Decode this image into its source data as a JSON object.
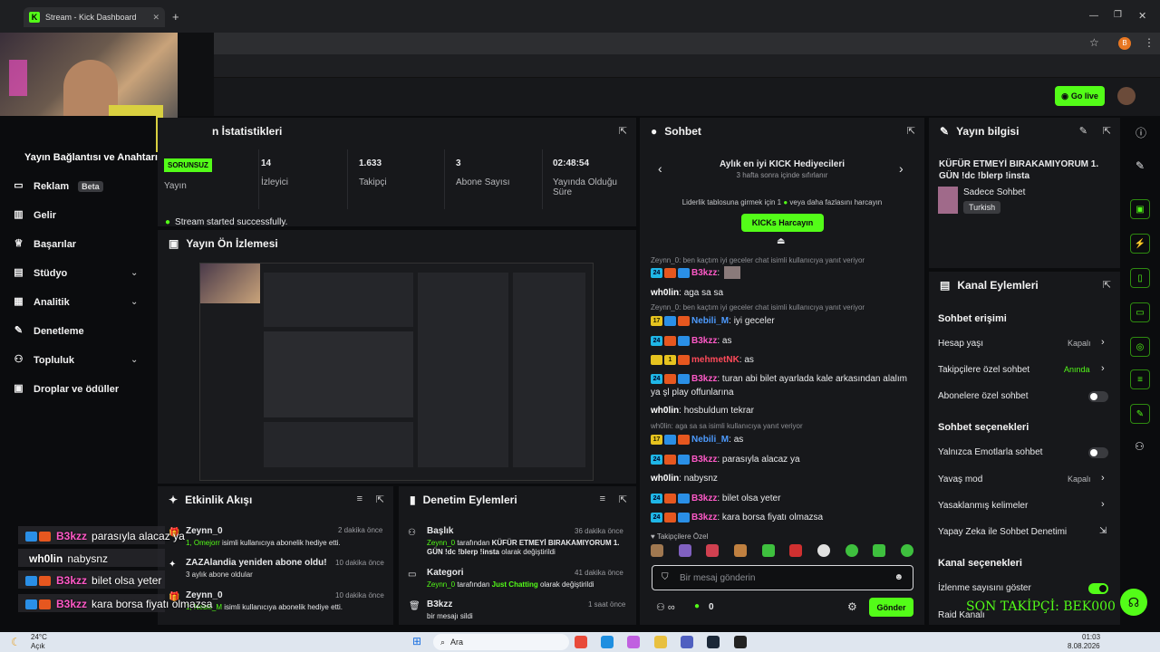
{
  "browser": {
    "tab_title": "Stream - Kick Dashboard",
    "tab_close": "✕",
    "new_tab": "+",
    "profile_initial": "B"
  },
  "header": {
    "go_live_label": "Go live"
  },
  "sidebar": {
    "title": "Yayın Bağlantısı ve Anahtarı",
    "items": [
      {
        "label": "Reklam",
        "badge": "Beta"
      },
      {
        "label": "Gelir"
      },
      {
        "label": "Başarılar"
      },
      {
        "label": "Stüdyo"
      },
      {
        "label": "Analitik"
      },
      {
        "label": "Denetleme"
      },
      {
        "label": "Topluluk"
      },
      {
        "label": "Droplar ve ödüller"
      }
    ]
  },
  "stats": {
    "title": "n İstatistikleri",
    "status_badge": "SORUNSUZ",
    "items": [
      {
        "value": "",
        "label": "Yayın"
      },
      {
        "value": "14",
        "label": "İzleyici"
      },
      {
        "value": "1.633",
        "label": "Takipçi"
      },
      {
        "value": "3",
        "label": "Abone Sayısı"
      },
      {
        "value": "02:48:54",
        "label": "Yayında Olduğu Süre"
      }
    ],
    "success_message": "Stream started successfully."
  },
  "preview": {
    "title": "Yayın Ön İzlemesi"
  },
  "activity": {
    "title": "Etkinlik Akışı",
    "events": [
      {
        "user": "Zeynn_0",
        "time": "2 dakika önce",
        "desc_user": "1, Omejorr",
        "desc": " isimli kullanıcıya abonelik hediye etti."
      },
      {
        "user": "ZAZAlandia yeniden abone oldu!",
        "time": "10 dakika önce",
        "desc_user": "",
        "desc": "3 aylık abone oldular"
      },
      {
        "user": "Zeynn_0",
        "time": "10 dakika önce",
        "desc_user": "1, Nebili_M",
        "desc": " isimli kullanıcıya abonelik hediye etti."
      }
    ]
  },
  "moderation": {
    "title": "Denetim Eylemleri",
    "items": [
      {
        "title": "Başlık",
        "time": "36 dakika önce",
        "who": "Zeynn_0",
        "mid": " tarafından ",
        "what": "KÜFÜR ETMEYİ BIRAKAMIYORUM 1. GÜN !dc !blerp !insta",
        "end": " olarak değiştirildi"
      },
      {
        "title": "Kategori",
        "time": "41 dakika önce",
        "who": "Zeynn_0",
        "mid": " tarafından ",
        "what": "Just Chatting",
        "end": " olarak değiştirildi"
      },
      {
        "title": "B3kzz",
        "time": "1 saat önce",
        "who": "",
        "mid": "",
        "what": "",
        "end": "bir mesajı sildi"
      }
    ]
  },
  "chat": {
    "title": "Sohbet",
    "gifters_title": "Aylık en iyi KICK Hediyecileri",
    "gifters_sub": "3 hafta sonra içinde sıfırlanır",
    "leaderboard_note": "Liderlik tablosuna girmek için 1 ",
    "leaderboard_note2": " veya daha fazlasını harcayın",
    "spend_button": "KICKs Harcayın",
    "followers_only": "Takipçilere Özel",
    "input_placeholder": "Bir mesaj gönderin",
    "send_button": "Gönder",
    "kicks_count": "0",
    "messages": [
      {
        "reply": "Zeynn_0: ben kaçtım iyi geceler chat isimli kullanıcıya yanıt veriyor",
        "badges": [
          "24",
          "mod",
          "sub"
        ],
        "user": "B3kzz",
        "color": "pink",
        "text": ""
      },
      {
        "reply": "",
        "badges": [],
        "user": "wh0lin",
        "color": "white",
        "text": "aga sa sa"
      },
      {
        "reply": "Zeynn_0: ben kaçtım iyi geceler chat isimli kullanıcıya yanıt veriyor",
        "badges": [
          "17",
          "sub",
          "mod"
        ],
        "user": "Nebili_M",
        "color": "blue",
        "text": "iyi geceler"
      },
      {
        "reply": "",
        "badges": [
          "24",
          "mod",
          "sub"
        ],
        "user": "B3kzz",
        "color": "pink",
        "text": "as"
      },
      {
        "reply": "",
        "badges": [
          "crown",
          "1",
          "mod"
        ],
        "user": "mehmetNK",
        "color": "red",
        "text": "as"
      },
      {
        "reply": "",
        "badges": [
          "24",
          "mod",
          "sub"
        ],
        "user": "B3kzz",
        "color": "pink",
        "text": "turan abi bilet ayarlada kale arkasından alalım ya şl play offunlarına"
      },
      {
        "reply": "",
        "badges": [],
        "user": "wh0lin",
        "color": "white",
        "text": "hosbuldum tekrar"
      },
      {
        "reply": "wh0lin: aga sa sa isimli kullanıcıya yanıt veriyor",
        "badges": [
          "17",
          "sub",
          "mod"
        ],
        "user": "Nebili_M",
        "color": "blue",
        "text": "as"
      },
      {
        "reply": "",
        "badges": [
          "24",
          "mod",
          "sub"
        ],
        "user": "B3kzz",
        "color": "pink",
        "text": "parasıyla alacaz ya"
      },
      {
        "reply": "",
        "badges": [],
        "user": "wh0lin",
        "color": "white",
        "text": "nabysnz"
      },
      {
        "reply": "",
        "badges": [
          "24",
          "mod",
          "sub"
        ],
        "user": "B3kzz",
        "color": "pink",
        "text": "bilet olsa yeter"
      },
      {
        "reply": "",
        "badges": [
          "24",
          "mod",
          "sub"
        ],
        "user": "B3kzz",
        "color": "pink",
        "text": "kara borsa fiyatı olmazsa"
      }
    ]
  },
  "stream_info": {
    "title": "Yayın bilgisi",
    "stream_title": "KÜFÜR ETMEYİ BIRAKAMIYORUM 1. GÜN !dc !blerp !insta",
    "category": "Sadece Sohbet",
    "language": "Turkish"
  },
  "channel_actions": {
    "title": "Kanal Eylemleri",
    "chat_access": "Sohbet erişimi",
    "rows1": [
      {
        "label": "Hesap yaşı",
        "value": "Kapalı"
      },
      {
        "label": "Takipçilere özel sohbet",
        "value": "Anında"
      },
      {
        "label": "Abonelere özel sohbet",
        "value": ""
      }
    ],
    "chat_options": "Sohbet seçenekleri",
    "rows2": [
      {
        "label": "Yalnızca Emotlarla sohbet",
        "value": ""
      },
      {
        "label": "Yavaş mod",
        "value": "Kapalı"
      },
      {
        "label": "Yasaklanmış kelimeler",
        "value": ""
      },
      {
        "label": "Yapay Zeka ile Sohbet Denetimi",
        "value": ""
      }
    ],
    "channel_options": "Kanal seçenekleri",
    "rows3": [
      {
        "label": "İzlenme sayısını göster",
        "value": ""
      },
      {
        "label": "Raid Kanalı",
        "value": ""
      }
    ]
  },
  "overlay": {
    "last_follower": "SON TAKİPÇİ: BEK000",
    "chat": [
      {
        "user": "B3kzz",
        "text": "parasıyla alacaz ya"
      },
      {
        "user": "wh0lin",
        "text": "nabysnz"
      },
      {
        "user": "B3kzz",
        "text": "bilet olsa yeter"
      },
      {
        "user": "B3kzz",
        "text": "kara borsa fiyatı olmazsa"
      }
    ]
  },
  "taskbar": {
    "weather_temp": "24°C",
    "weather_desc": "Açık",
    "search_label": "Ara",
    "time": "01:03",
    "date": "8.08.2026"
  }
}
